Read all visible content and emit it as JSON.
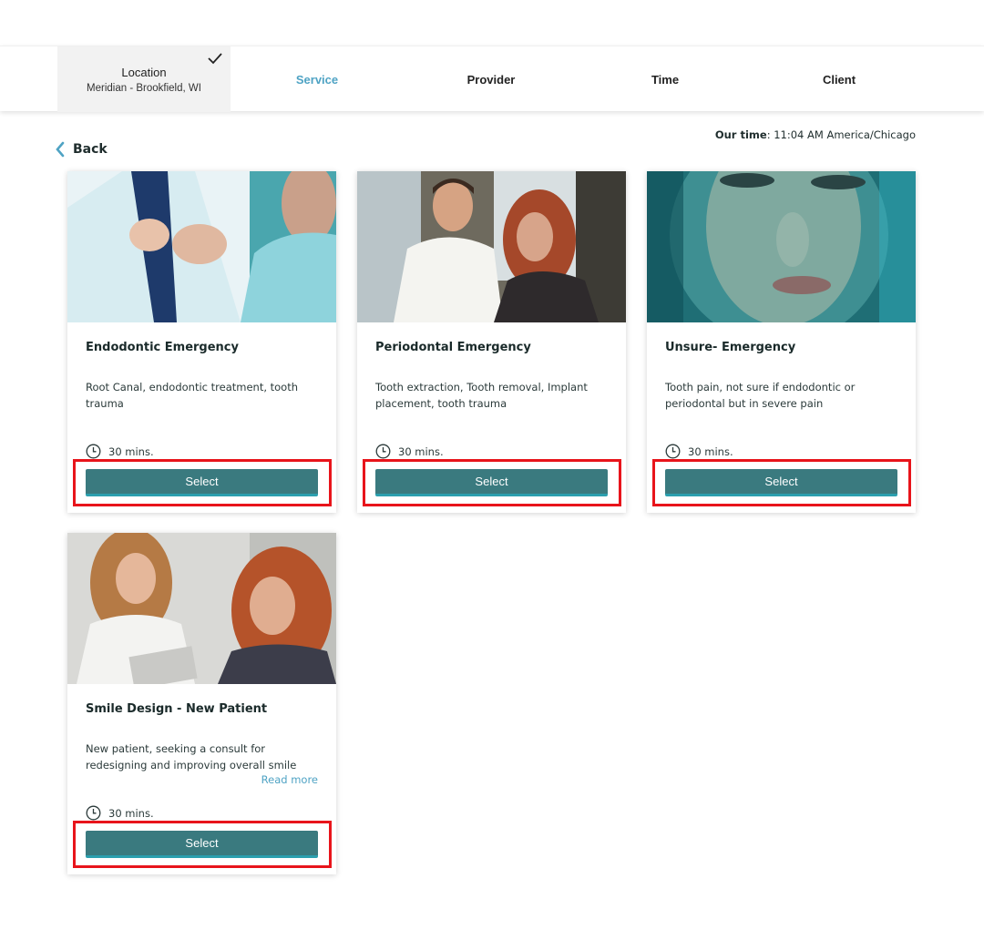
{
  "steps": [
    {
      "label": "Location",
      "sub": "Meridian - Brookfield, WI"
    },
    {
      "label": "Service"
    },
    {
      "label": "Provider"
    },
    {
      "label": "Time"
    },
    {
      "label": "Client"
    }
  ],
  "back_label": "Back",
  "time": {
    "label": "Our time",
    "value": ": 11:04 AM America/Chicago"
  },
  "cards": [
    {
      "title": "Endodontic Emergency",
      "desc": "Root Canal, endodontic treatment, tooth trauma",
      "duration": "30 mins.",
      "select": "Select"
    },
    {
      "title": "Periodontal Emergency",
      "desc": "Tooth extraction, Tooth removal, Implant placement, tooth trauma",
      "duration": "30 mins.",
      "select": "Select"
    },
    {
      "title": "Unsure- Emergency",
      "desc": "Tooth pain, not sure if endodontic or periodontal but in severe pain",
      "duration": "30 mins.",
      "select": "Select"
    },
    {
      "title": "Smile Design - New Patient",
      "desc": "New patient, seeking a consult for redesigning and improving overall smile",
      "read_more": "Read more",
      "duration": "30 mins.",
      "select": "Select"
    }
  ],
  "colors": {
    "accent": "#4fa3c4",
    "button": "#3a7a7f",
    "highlight": "#e8141b"
  }
}
